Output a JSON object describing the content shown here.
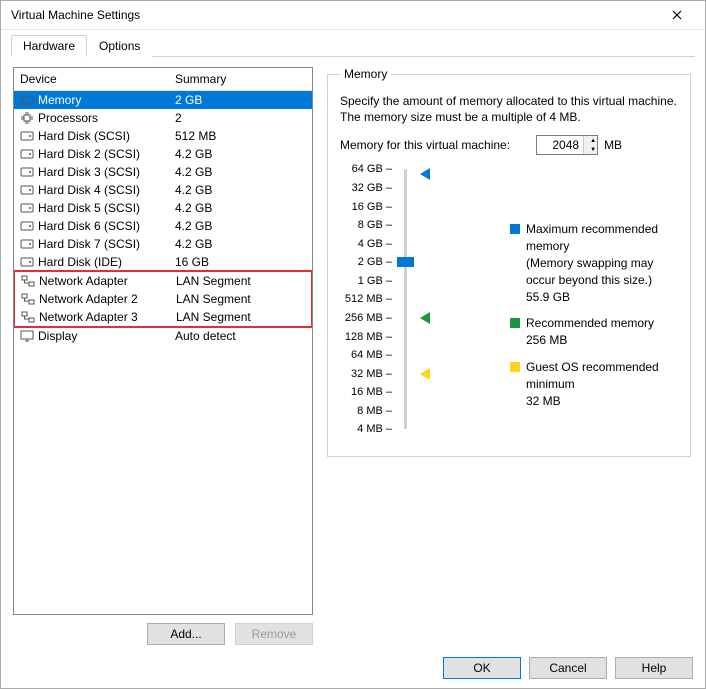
{
  "title": "Virtual Machine Settings",
  "tabs": {
    "hardware": "Hardware",
    "options": "Options"
  },
  "list": {
    "header_device": "Device",
    "header_summary": "Summary",
    "rows": [
      {
        "icon": "memory",
        "name": "Memory",
        "summary": "2 GB"
      },
      {
        "icon": "cpu",
        "name": "Processors",
        "summary": "2"
      },
      {
        "icon": "disk",
        "name": "Hard Disk (SCSI)",
        "summary": "512 MB"
      },
      {
        "icon": "disk",
        "name": "Hard Disk 2 (SCSI)",
        "summary": "4.2 GB"
      },
      {
        "icon": "disk",
        "name": "Hard Disk 3 (SCSI)",
        "summary": "4.2 GB"
      },
      {
        "icon": "disk",
        "name": "Hard Disk 4 (SCSI)",
        "summary": "4.2 GB"
      },
      {
        "icon": "disk",
        "name": "Hard Disk 5 (SCSI)",
        "summary": "4.2 GB"
      },
      {
        "icon": "disk",
        "name": "Hard Disk 6 (SCSI)",
        "summary": "4.2 GB"
      },
      {
        "icon": "disk",
        "name": "Hard Disk 7 (SCSI)",
        "summary": "4.2 GB"
      },
      {
        "icon": "disk",
        "name": "Hard Disk (IDE)",
        "summary": "16 GB"
      },
      {
        "icon": "net",
        "name": "Network Adapter",
        "summary": "LAN Segment"
      },
      {
        "icon": "net",
        "name": "Network Adapter 2",
        "summary": "LAN Segment"
      },
      {
        "icon": "net",
        "name": "Network Adapter 3",
        "summary": "LAN Segment"
      },
      {
        "icon": "display",
        "name": "Display",
        "summary": "Auto detect"
      }
    ],
    "selected_index": 0,
    "highlight_start": 10,
    "highlight_end": 12
  },
  "buttons": {
    "add": "Add...",
    "remove": "Remove",
    "ok": "OK",
    "cancel": "Cancel",
    "help": "Help"
  },
  "memory": {
    "legend_title": "Memory",
    "desc": "Specify the amount of memory allocated to this virtual machine. The memory size must be a multiple of 4 MB.",
    "input_label": "Memory for this virtual machine:",
    "input_value": "2048",
    "input_unit": "MB",
    "ticks": [
      "64 GB",
      "32 GB",
      "16 GB",
      "8 GB",
      "4 GB",
      "2 GB",
      "1 GB",
      "512 MB",
      "256 MB",
      "128 MB",
      "64 MB",
      "32 MB",
      "16 MB",
      "8 MB",
      "4 MB"
    ],
    "max_label": "Maximum recommended memory",
    "max_sub": "(Memory swapping may occur beyond this size.)",
    "max_val": "55.9 GB",
    "rec_label": "Recommended memory",
    "rec_val": "256 MB",
    "min_label": "Guest OS recommended minimum",
    "min_val": "32 MB"
  }
}
